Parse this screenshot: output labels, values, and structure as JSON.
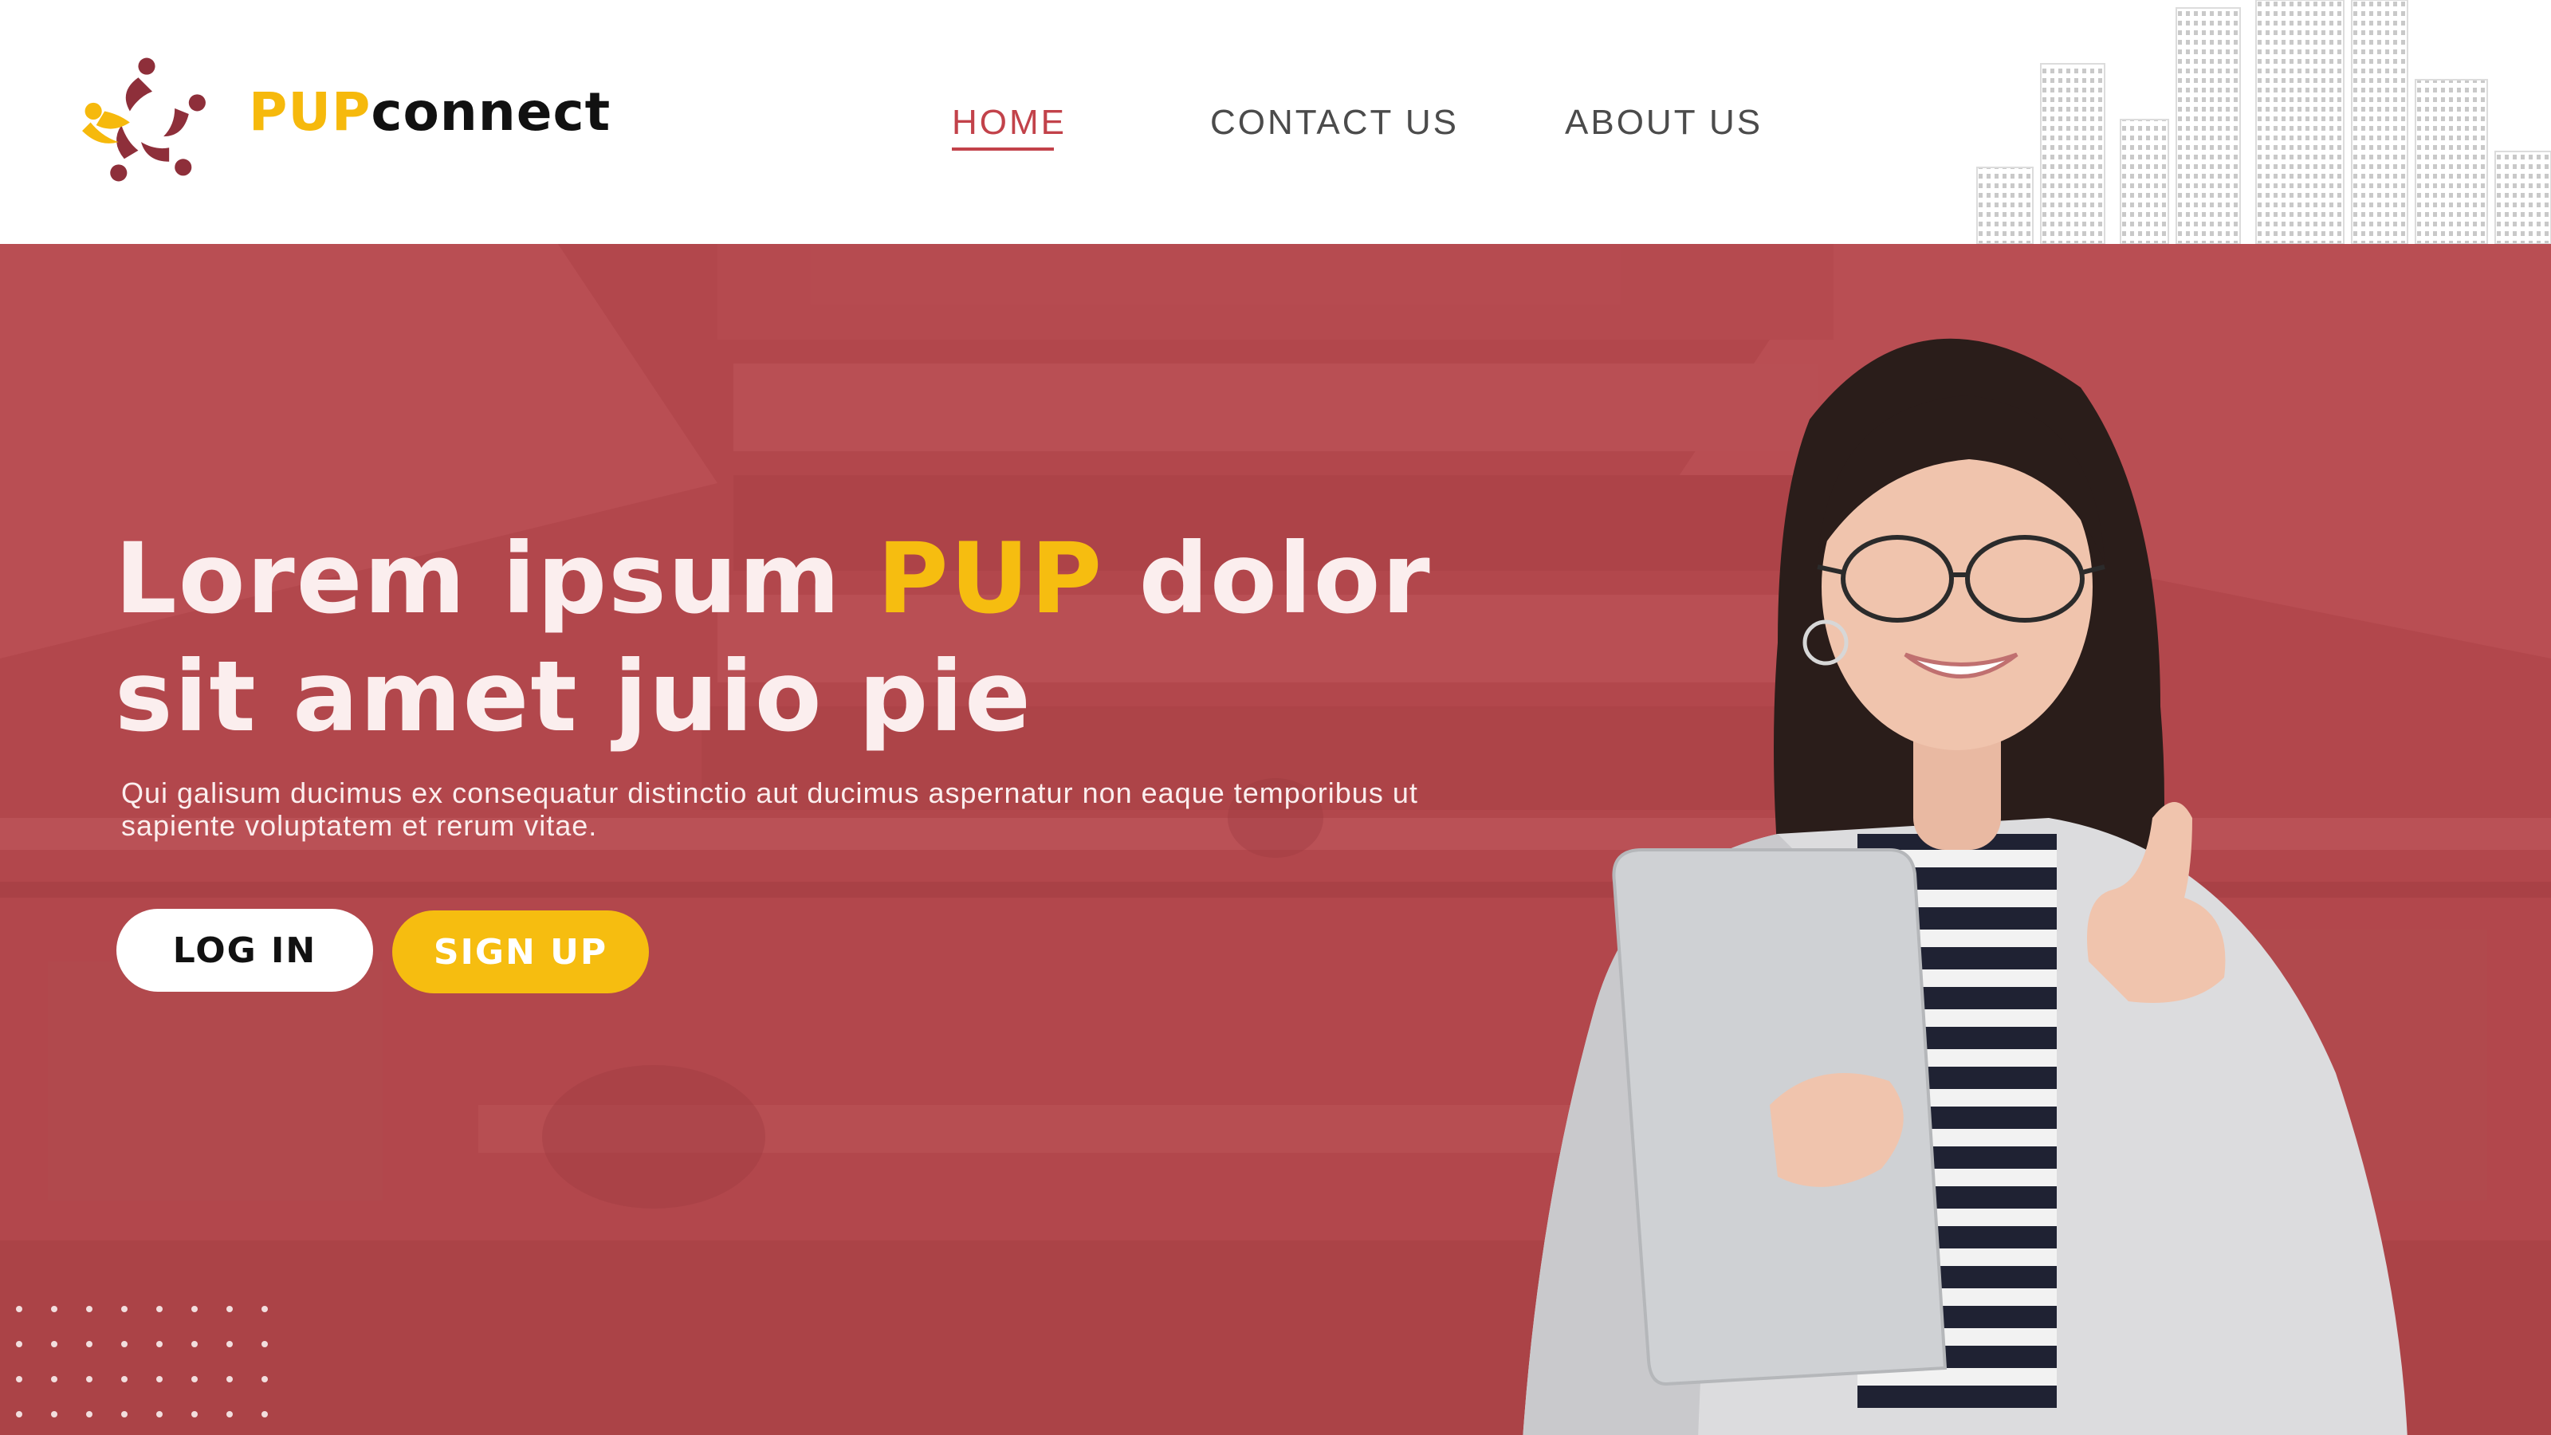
{
  "brand": {
    "part1": "PUP",
    "part2": "connect"
  },
  "nav": {
    "items": [
      {
        "label": "HOME",
        "active": true
      },
      {
        "label": "CONTACT US",
        "active": false
      },
      {
        "label": "ABOUT US",
        "active": false
      }
    ]
  },
  "hero": {
    "headline_before": "Lorem ipsum ",
    "headline_accent": "PUP",
    "headline_after": " dolor sit amet juio pie",
    "subtext": "Qui galisum ducimus ex consequatur distinctio aut ducimus aspernatur non eaque temporibus ut sapiente voluptatem et rerum vitae.",
    "login_label": "LOG IN",
    "signup_label": "SIGN UP"
  },
  "colors": {
    "primary": "#b2474c",
    "accent_yellow": "#f6bd10",
    "active_nav": "#c2424a",
    "nav_text": "#4b4b4b"
  },
  "icons": [
    "people-circle-logo-icon",
    "city-skyline-icon",
    "dot-grid-icon"
  ]
}
